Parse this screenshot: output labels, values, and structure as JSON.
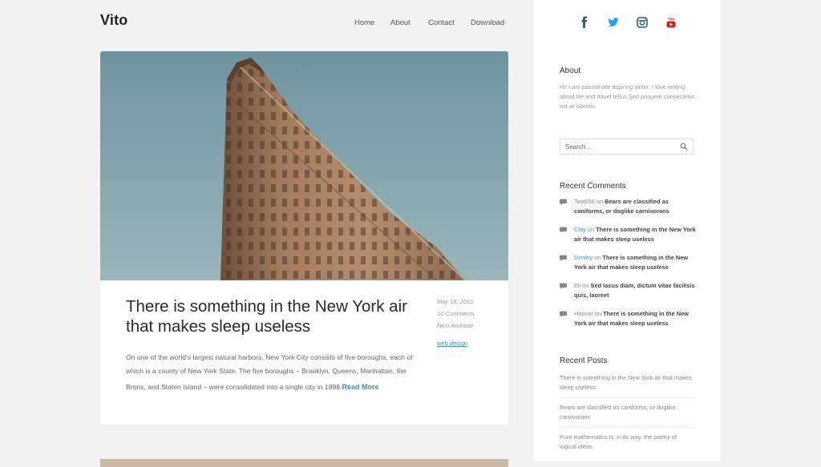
{
  "site": {
    "title": "Vito"
  },
  "nav": {
    "items": [
      {
        "label": "Home"
      },
      {
        "label": "About"
      },
      {
        "label": "Contact"
      },
      {
        "label": "Download"
      }
    ]
  },
  "post": {
    "title": "There is something in the New York air that makes sleep useless",
    "date": "May 18, 2012",
    "comments": "10 Comments",
    "author": "Nico Andrade",
    "category": "web design",
    "excerpt_main": "On one of the world's largest natural harbors, New York City consists of five boroughs, each of which is a county of New York State. The five boroughs – Brooklyn, Queens, Manhattan, the",
    "excerpt_last": "Bronx, and Staten Island – were consolidated into a single city in 1898.",
    "read_more": "Read More"
  },
  "sidebar": {
    "about": {
      "title": "About",
      "text": "Hi! I am passionate aspiring writer, I love writing about life and travel tellus Sed posuere consectetur est at lobortis."
    },
    "search": {
      "placeholder": "Search ..."
    },
    "recent_comments": {
      "title": "Recent Comments",
      "items": [
        {
          "author": "Test656",
          "on": " on ",
          "post": "Bears are classified as caniforms, or doglike carnivorans"
        },
        {
          "author": "Clay",
          "on": " on ",
          "post": "There is something in the New York air that makes sleep useless"
        },
        {
          "author": "Dimitry",
          "on": " on ",
          "post": "There is something in the New York air that makes sleep useless"
        },
        {
          "author": "Eli",
          "on": " on ",
          "post": "Sed lacus diam, dictum vitae facilisis quis, laoreet"
        },
        {
          "author": "Hoover",
          "on": " on ",
          "post": "There is something in the New York air that makes sleep useless"
        }
      ]
    },
    "recent_posts": {
      "title": "Recent Posts",
      "items": [
        {
          "label": "There is something in the New York air that makes sleep useless"
        },
        {
          "label": "Bears are classified as caniforms, or doglike carnivorans"
        },
        {
          "label": "Pure mathematics is, in its way, the poetry of logical ideas."
        }
      ]
    }
  },
  "social": [
    {
      "icon": "facebook-icon",
      "color": "#3b5998"
    },
    {
      "icon": "twitter-icon",
      "color": "#1da1f2"
    },
    {
      "icon": "instagram-icon",
      "color": "#3f729b"
    },
    {
      "icon": "youtube-icon",
      "color": "#cd201f"
    }
  ],
  "colors": {
    "link": "#3a8fc8",
    "sky": "#7e9eaa",
    "building": "#a07d60"
  }
}
